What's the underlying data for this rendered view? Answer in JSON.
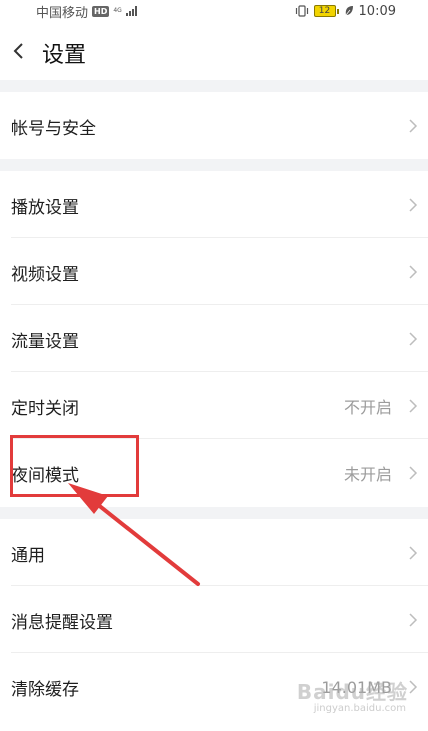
{
  "status_bar": {
    "carrier": "中国移动",
    "hd": "HD",
    "net_top": "4G",
    "net_bottom": "ℍ",
    "battery": "12",
    "time": "10:09"
  },
  "header": {
    "title": "设置"
  },
  "rows": [
    {
      "label": "帐号与安全",
      "value": ""
    },
    {
      "label": "播放设置",
      "value": ""
    },
    {
      "label": "视频设置",
      "value": ""
    },
    {
      "label": "流量设置",
      "value": ""
    },
    {
      "label": "定时关闭",
      "value": "不开启"
    },
    {
      "label": "夜间模式",
      "value": "未开启"
    },
    {
      "label": "通用",
      "value": ""
    },
    {
      "label": "消息提醒设置",
      "value": ""
    },
    {
      "label": "清除缓存",
      "value": "14.01MB"
    }
  ],
  "watermark": {
    "text": "Baidu经验",
    "sub": "jingyan.baidu.com"
  },
  "colors": {
    "highlight": "#e23b3b",
    "background": "#ffffff",
    "section_divider": "#f2f3f5"
  }
}
